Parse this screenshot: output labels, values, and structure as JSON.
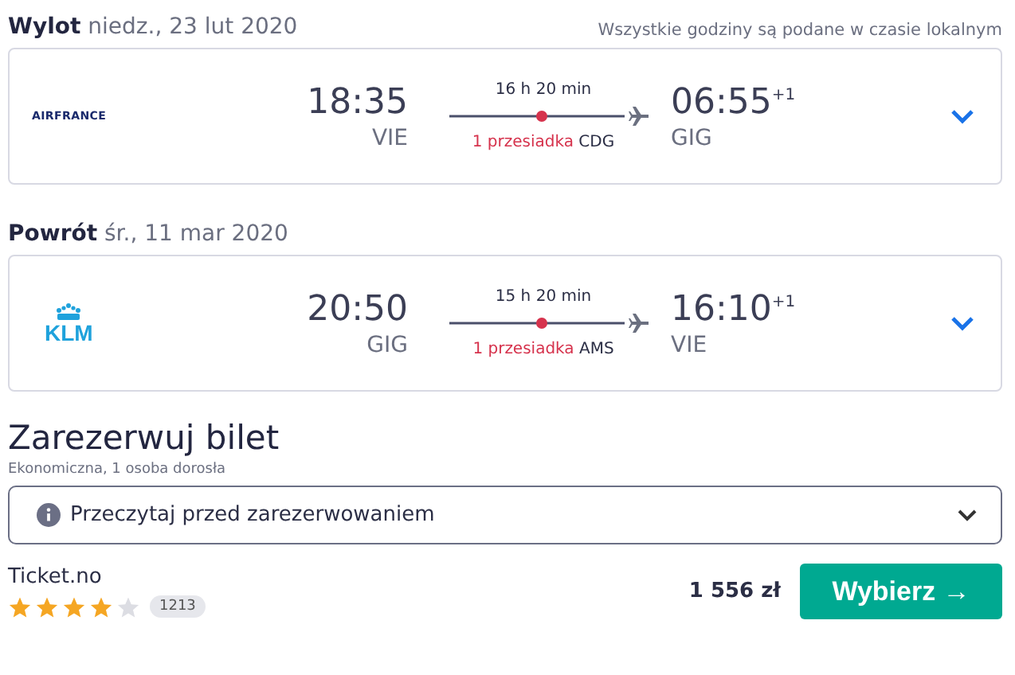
{
  "legs": [
    {
      "label": "Wylot",
      "date": "niedz., 23 lut 2020",
      "note": "Wszystkie godziny są podane w czasie lokalnym",
      "airline": {
        "kind": "airfrance",
        "name": "AIRFRANCE"
      },
      "depart_time": "18:35",
      "depart_code": "VIE",
      "duration": "16 h 20 min",
      "stops": "1 przesiadka",
      "via": "CDG",
      "arrive_time": "06:55",
      "day_offset": "+1",
      "arrive_code": "GIG"
    },
    {
      "label": "Powrót",
      "date": "śr., 11 mar 2020",
      "airline": {
        "kind": "klm",
        "name": "KLM"
      },
      "depart_time": "20:50",
      "depart_code": "GIG",
      "duration": "15 h 20 min",
      "stops": "1 przesiadka",
      "via": "AMS",
      "arrive_time": "16:10",
      "day_offset": "+1",
      "arrive_code": "VIE"
    }
  ],
  "booking": {
    "title": "Zarezerwuj bilet",
    "subtitle": "Ekonomiczna, 1 osoba dorosła",
    "notice": "Przeczytaj przed zarezerwowaniem",
    "provider": "Ticket.no",
    "stars": 4,
    "reviews": "1213",
    "price": "1 556 zł",
    "button": "Wybierz →"
  }
}
